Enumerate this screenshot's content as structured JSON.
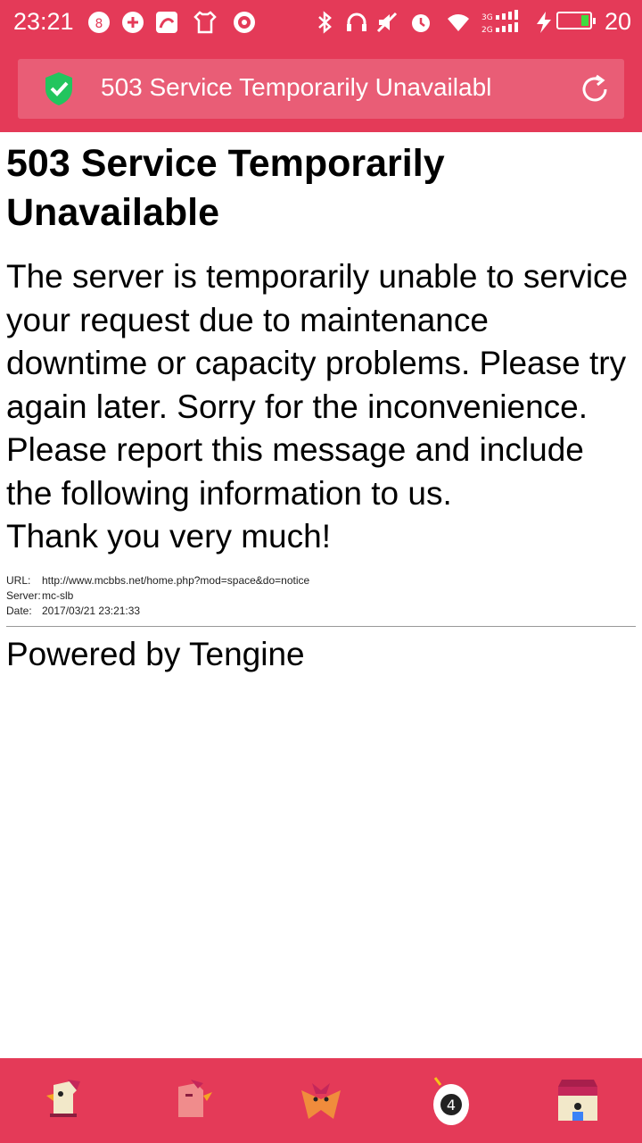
{
  "status_bar": {
    "time": "23:21",
    "battery_level": "20",
    "icons": [
      "app-icon-1",
      "app-icon-2",
      "app-icon-3",
      "shirt-icon",
      "target-icon",
      "bluetooth-icon",
      "headphones-icon",
      "mute-icon",
      "alarm-icon",
      "wifi-icon",
      "signal-icon",
      "charging-icon",
      "battery-icon"
    ]
  },
  "address_bar": {
    "url_title": "503 Service Temporarily Unavailabl",
    "secure_icon": "shield-check-icon",
    "reload_icon": "reload-icon"
  },
  "page": {
    "title": "503 Service Temporarily Unavailable",
    "paragraph_1": "The server is temporarily unable to service your request due to maintenance downtime or capacity problems. Please try again later. Sorry for the inconvenience.",
    "paragraph_2": "Please report this message and include the following information to us.",
    "paragraph_3": "Thank you very much!",
    "info": [
      {
        "label": "URL:",
        "value": "http://www.mcbbs.net/home.php?mod=space&do=notice"
      },
      {
        "label": "Server:",
        "value": "mc-slb"
      },
      {
        "label": "Date:",
        "value": "2017/03/21 23:21:33"
      }
    ],
    "footer": "Powered by Tengine"
  },
  "bottom_nav": {
    "items": [
      {
        "name": "rooster-home-icon"
      },
      {
        "name": "rooster-icon"
      },
      {
        "name": "fox-icon"
      },
      {
        "name": "egg-icon",
        "badge": "4"
      },
      {
        "name": "house-icon"
      }
    ]
  },
  "colors": {
    "accent": "#e43a58",
    "secure": "#22c55e"
  }
}
